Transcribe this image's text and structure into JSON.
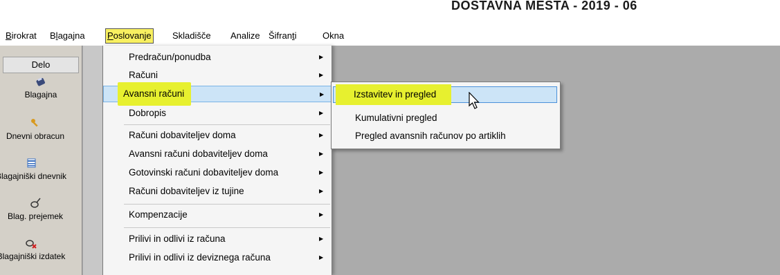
{
  "window": {
    "title": "DOSTAVNA MESTA - 2019 - 06"
  },
  "menubar": {
    "items": [
      {
        "label": "Birokrat",
        "accel": "B",
        "rest": "irokrat"
      },
      {
        "label": "Blagajna",
        "pre": "B",
        "accel": "l",
        "rest": "agajna"
      },
      {
        "label": "Poslovanje",
        "accel": "P",
        "rest": "oslovanje",
        "active": true
      },
      {
        "label": "Skladišče"
      },
      {
        "label": "Analize"
      },
      {
        "label": "Šifranti",
        "pre": "Šifran",
        "accel": "t",
        "rest": "i"
      },
      {
        "label": "Okna"
      }
    ]
  },
  "sidebar": {
    "header": "Delo",
    "items": [
      {
        "label": "Blagajna",
        "icon": "wallet-icon"
      },
      {
        "label": "Dnevni obracun",
        "icon": "key-icon"
      },
      {
        "label": "Blagajniški dnevnik",
        "icon": "ledger-icon"
      },
      {
        "label": "Blag. prejemek",
        "icon": "pin-icon"
      },
      {
        "label": "Blagajniški izdatek",
        "icon": "pin-remove-icon"
      }
    ]
  },
  "dropdown": {
    "items": [
      {
        "label": "Predračun/ponudba",
        "submenu": true
      },
      {
        "label": "Računi",
        "submenu": true
      },
      {
        "label": "Avansni računi",
        "submenu": true,
        "highlighted": true
      },
      {
        "label": "Dobropis",
        "submenu": true
      },
      {
        "label": "Računi dobaviteljev doma",
        "submenu": true
      },
      {
        "label": "Avansni računi dobaviteljev doma",
        "submenu": true
      },
      {
        "label": "Gotovinski računi dobaviteljev doma",
        "submenu": true
      },
      {
        "label": "Računi dobaviteljev iz tujine",
        "submenu": true
      },
      {
        "label": "Kompenzacije",
        "submenu": true
      },
      {
        "label": "Prilivi in odlivi iz računa",
        "submenu": true
      },
      {
        "label": "Prilivi in odlivi iz deviznega računa",
        "submenu": true
      }
    ]
  },
  "submenu": {
    "items": [
      {
        "label": "Izstavitev in pregled",
        "highlighted": true
      },
      {
        "label": "Kumulativni pregled"
      },
      {
        "label": "Pregled avansnih računov po artiklih"
      }
    ]
  },
  "colors": {
    "highlight_yellow": "#e7f02f",
    "selection_blue": "#cce4f7",
    "workspace_gray": "#ababab"
  }
}
